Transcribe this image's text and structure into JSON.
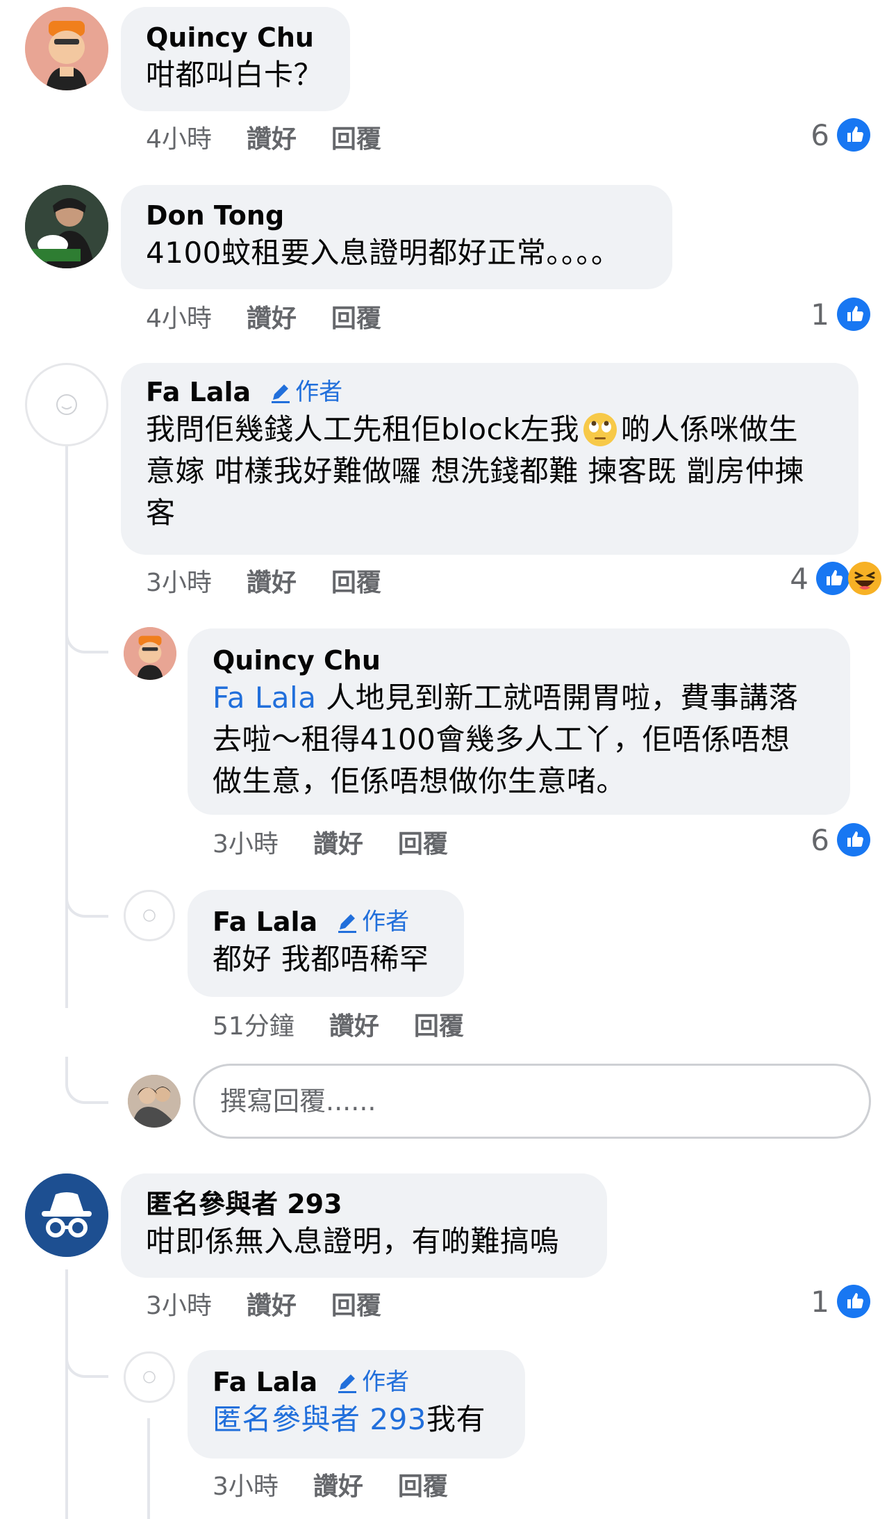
{
  "colors": {
    "accent": "#216fdb",
    "like_blue": "#1877f2",
    "bubble": "#f0f2f5",
    "muted": "#65676b"
  },
  "labels": {
    "like": "讚好",
    "reply": "回覆",
    "author": "作者"
  },
  "comments": [
    {
      "name": "Quincy Chu",
      "text": "咁都叫白卡？",
      "time": "4小時",
      "reactions": {
        "count": "6",
        "icons": [
          "like-icon"
        ]
      }
    },
    {
      "name": "Don Tong",
      "text": "4100蚊租要入息證明都好正常。。。。",
      "time": "4小時",
      "reactions": {
        "count": "1",
        "icons": [
          "like-icon"
        ]
      }
    },
    {
      "name": "Fa Lala",
      "is_author": true,
      "text_line1_a": "我問佢幾錢人工先租佢block左我",
      "emoji": "face-with-rolling-eyes-icon",
      "text_line1_b": "啲人係咪做生",
      "text_line2": "意嫁 咁樣我好難做囉 想洗錢都難 揀客既 劏房仲揀",
      "text_line3": "客",
      "time": "3小時",
      "reactions": {
        "count": "4",
        "icons": [
          "like-icon",
          "haha-icon"
        ]
      }
    },
    {
      "name": "Quincy Chu",
      "mention": "Fa Lala",
      "text_line1": " 人地見到新工就唔開胃啦，費事講落",
      "text_line2": "去啦～租得4100會幾多人工丫，佢唔係唔想",
      "text_line3": "做生意，佢係唔想做你生意啫。",
      "time": "3小時",
      "reactions": {
        "count": "6",
        "icons": [
          "like-icon"
        ]
      }
    },
    {
      "name": "Fa Lala",
      "is_author": true,
      "text": "都好 我都唔稀罕",
      "time": "51分鐘"
    },
    {
      "name": "匿名參與者 293",
      "text": "咁即係無入息證明，有啲難搞嗚",
      "time": "3小時",
      "reactions": {
        "count": "1",
        "icons": [
          "like-icon"
        ]
      }
    },
    {
      "name": "Fa Lala",
      "is_author": true,
      "mention": "匿名參與者 293",
      "text": "我有",
      "time": "3小時"
    }
  ],
  "reply_box": {
    "placeholder": "撰寫回覆......"
  }
}
